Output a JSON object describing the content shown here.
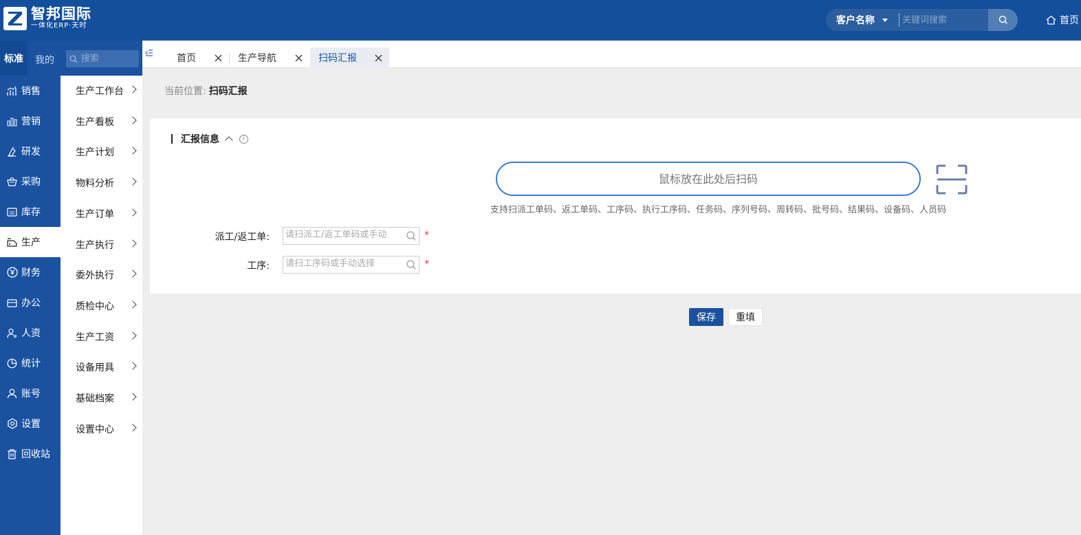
{
  "header": {
    "logo_title": "智邦国际",
    "logo_sub": "一体化ERP·天时",
    "search_select": "客户名称",
    "search_placeholder": "关键词搜索",
    "home_label": "首页"
  },
  "sidebar": {
    "tab_standard": "标准",
    "tab_mine": "我的",
    "search_placeholder": "搜索",
    "items": [
      {
        "label": "销售",
        "icon": "chart-line-icon"
      },
      {
        "label": "营销",
        "icon": "bar-chart-icon"
      },
      {
        "label": "研发",
        "icon": "flask-icon"
      },
      {
        "label": "采购",
        "icon": "basket-icon"
      },
      {
        "label": "库存",
        "icon": "warehouse-icon"
      },
      {
        "label": "生产",
        "icon": "factory-icon"
      },
      {
        "label": "财务",
        "icon": "yen-icon"
      },
      {
        "label": "办公",
        "icon": "briefcase-icon"
      },
      {
        "label": "人资",
        "icon": "person-card-icon"
      },
      {
        "label": "统计",
        "icon": "pie-chart-icon"
      },
      {
        "label": "账号",
        "icon": "user-icon"
      },
      {
        "label": "设置",
        "icon": "gear-icon"
      },
      {
        "label": "回收站",
        "icon": "trash-icon"
      }
    ],
    "active_index": 5
  },
  "submenu": {
    "items": [
      "生产工作台",
      "生产看板",
      "生产计划",
      "物料分析",
      "生产订单",
      "生产执行",
      "委外执行",
      "质检中心",
      "生产工资",
      "设备用具",
      "基础档案",
      "设置中心"
    ]
  },
  "tabs": [
    {
      "label": "首页",
      "active": false
    },
    {
      "label": "生产导航",
      "active": false
    },
    {
      "label": "扫码汇报",
      "active": true
    }
  ],
  "breadcrumb": {
    "prefix": "当前位置:",
    "current": "扫码汇报"
  },
  "section": {
    "title": "汇报信息",
    "info": "i"
  },
  "scan": {
    "placeholder": "鼠标放在此处后扫码",
    "hint": "支持扫派工单码、返工单码、工序码、执行工序码、任务码、序列号码、周转码、批号码、结果码、设备码、人员码"
  },
  "form": {
    "dispatch_label": "派工/返工单:",
    "dispatch_placeholder": "请扫派工/返工单码或手动",
    "process_label": "工序:",
    "process_placeholder": "请扫工序码或手动选择",
    "required_mark": "*"
  },
  "actions": {
    "save": "保存",
    "reset": "重填"
  },
  "colors": {
    "brand": "#144f9c",
    "sidebar": "#1a52a0",
    "scan_border": "#3a78d8",
    "required": "#ee3333"
  }
}
